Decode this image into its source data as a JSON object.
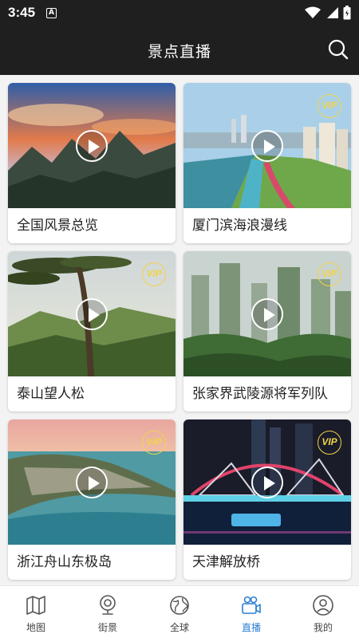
{
  "status_bar": {
    "time": "3:45",
    "notification_icon": "A"
  },
  "header": {
    "title": "景点直播",
    "search_icon": "search-icon"
  },
  "cards": [
    {
      "name": "全国风景总览",
      "vip": false,
      "scene": "mountain-sunset"
    },
    {
      "name": "厦门滨海浪漫线",
      "vip": true,
      "vip_label": "VIP",
      "scene": "coastal-city"
    },
    {
      "name": "泰山望人松",
      "vip": true,
      "vip_label": "VIP",
      "scene": "pine-tree"
    },
    {
      "name": "张家界武陵源将军列队",
      "vip": true,
      "vip_label": "VIP",
      "scene": "karst-peaks"
    },
    {
      "name": "浙江舟山东极岛",
      "vip": true,
      "vip_label": "VIP",
      "scene": "island-bay"
    },
    {
      "name": "天津解放桥",
      "vip": true,
      "vip_label": "VIP",
      "scene": "night-bridge"
    }
  ],
  "tabs": [
    {
      "label": "地图",
      "icon": "map-icon",
      "active": false
    },
    {
      "label": "街景",
      "icon": "street-view-icon",
      "active": false
    },
    {
      "label": "全球",
      "icon": "globe-icon",
      "active": false
    },
    {
      "label": "直播",
      "icon": "live-camera-icon",
      "active": true
    },
    {
      "label": "我的",
      "icon": "profile-icon",
      "active": false
    }
  ],
  "colors": {
    "header_bg": "#1f1f1f",
    "active_tab": "#2a7fd4",
    "vip": "#f2d34a",
    "page_bg": "#f3f3f3"
  }
}
